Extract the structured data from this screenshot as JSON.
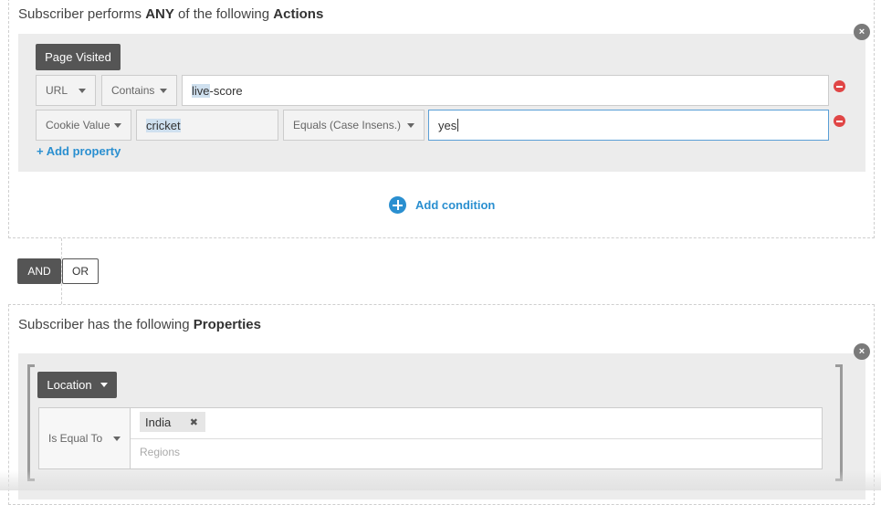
{
  "actions_section": {
    "title_prefix": "Subscriber performs ",
    "title_bold1": "ANY",
    "title_mid": " of the following ",
    "title_bold2": "Actions",
    "close_symbol": "×",
    "event_button": "Page Visited",
    "rows": [
      {
        "select1": "URL",
        "select2": "Contains",
        "value_highlight": "live",
        "value_rest": "-score"
      },
      {
        "select1": "Cookie Value",
        "cookie_name": "cricket",
        "select2": "Equals (Case Insens.)",
        "value": "yes"
      }
    ],
    "add_property": "+ Add property",
    "add_condition": "Add condition",
    "add_condition_icon": "plus-circle-icon"
  },
  "logic_toggle": {
    "and_label": "AND",
    "or_label": "OR",
    "selected": "AND"
  },
  "properties_section": {
    "title_prefix": "Subscriber has the following ",
    "title_bold": "Properties",
    "close_symbol": "×",
    "property_button": "Location",
    "operator": "Is Equal To",
    "tags": [
      {
        "label": "India",
        "remove_symbol": "✖"
      }
    ],
    "regions_placeholder": "Regions"
  },
  "colors": {
    "accent_blue": "#2a8fd0",
    "remove_red": "#e04646",
    "dark_button": "#555555"
  }
}
